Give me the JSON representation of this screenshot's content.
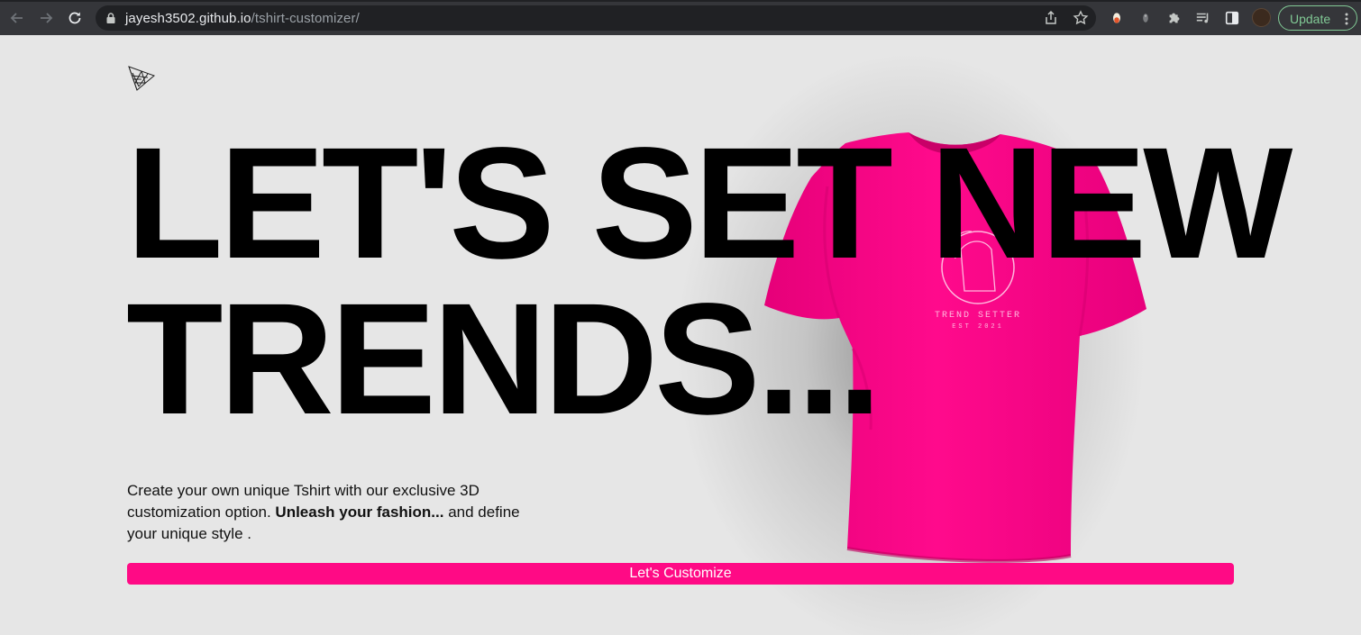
{
  "browser": {
    "url_domain": "jayesh3502.github.io",
    "url_path": "/tshirt-customizer/",
    "update_label": "Update",
    "toolbar_icons": [
      "back-icon",
      "forward-icon",
      "reload-icon",
      "lock-icon",
      "share-icon",
      "star-icon",
      "extension-icon",
      "extension-icon",
      "puzzle-icon",
      "media-icon",
      "sidepanel-icon",
      "avatar",
      "menu-icon"
    ]
  },
  "hero": {
    "headline_line1": "LET'S SET NEW",
    "headline_line2": "TRENDS...",
    "description_part1": "Create your own unique Tshirt with our exclusive 3D customization option. ",
    "description_bold": "Unleash your fashion...",
    "description_part2": " and define your unique style .",
    "cta_label": "Let's Customize",
    "shirt_print_text": "TREND SETTER",
    "shirt_print_subtext": "EST 2021"
  },
  "colors": {
    "accent": "#ff0a85",
    "shirt": "#ff0a8c",
    "background": "#e6e6e6",
    "text": "#000000"
  }
}
